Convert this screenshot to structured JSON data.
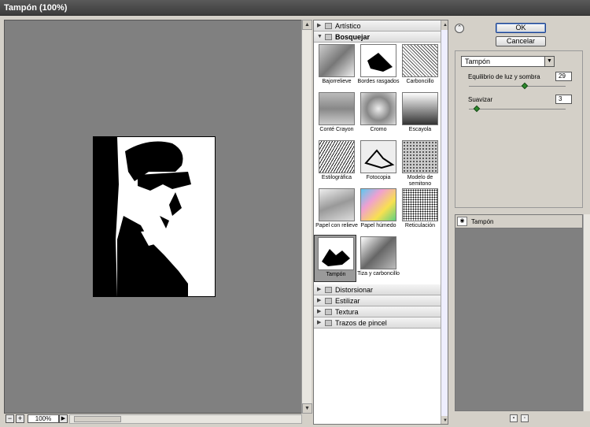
{
  "window": {
    "title": "Tampón (100%)"
  },
  "preview": {
    "zoom_out": "−",
    "zoom_in": "+",
    "zoom_value": "100%",
    "menu_arrow": "▶"
  },
  "filters": {
    "categories_top": [
      {
        "label": "Artístico",
        "expanded": false
      },
      {
        "label": "Bosquejar",
        "expanded": true
      }
    ],
    "thumbnails": [
      {
        "label": "Bajorrelieve"
      },
      {
        "label": "Bordes rasgados"
      },
      {
        "label": "Carboncillo"
      },
      {
        "label": "Conté Crayon"
      },
      {
        "label": "Cromo"
      },
      {
        "label": "Escayola"
      },
      {
        "label": "Estilográfica"
      },
      {
        "label": "Fotocopia"
      },
      {
        "label": "Modelo de semitono"
      },
      {
        "label": "Papel con relieve"
      },
      {
        "label": "Papel húmedo"
      },
      {
        "label": "Reticulación"
      },
      {
        "label": "Tampón",
        "selected": true
      },
      {
        "label": "Tiza y carboncillo"
      }
    ],
    "categories_bottom": [
      {
        "label": "Distorsionar"
      },
      {
        "label": "Estilizar"
      },
      {
        "label": "Textura"
      },
      {
        "label": "Trazos de pincel"
      }
    ]
  },
  "buttons": {
    "ok": "OK",
    "cancel": "Cancelar"
  },
  "settings": {
    "filter_select": "Tampón",
    "params": [
      {
        "label": "Equilibrio de luz y sombra",
        "value": "29",
        "fraction": 0.58
      },
      {
        "label": "Suavizar",
        "value": "3",
        "fraction": 0.06
      }
    ]
  },
  "layers": {
    "row_label": "Tampón"
  },
  "colors": {
    "selected_thumb": "#9a9a9a",
    "slider_knob": "#2a8a2a"
  }
}
